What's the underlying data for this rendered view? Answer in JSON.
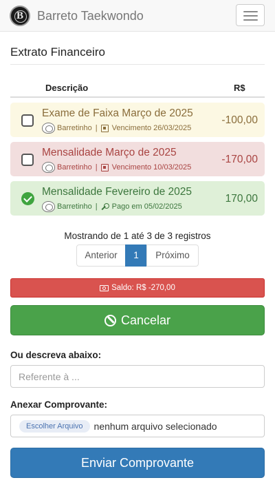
{
  "navbar": {
    "logo_letter": "B",
    "brand": "Barreto Taekwondo"
  },
  "page": {
    "title": "Extrato Financeiro"
  },
  "table": {
    "headers": {
      "description": "Descrição",
      "amount": "R$"
    },
    "rows": [
      {
        "status": "warning",
        "checked": false,
        "description": "Exame de Faixa Março de 2025",
        "user": "Barretinho",
        "date_text": "Vencimento 26/03/2025",
        "date_icon": "calendar-icon",
        "amount": "-100,00"
      },
      {
        "status": "danger",
        "checked": false,
        "description": "Mensalidade Março de 2025",
        "user": "Barretinho",
        "date_text": "Vencimento 10/03/2025",
        "date_icon": "calendar-icon",
        "amount": "-170,00"
      },
      {
        "status": "success",
        "checked": true,
        "description": "Mensalidade Fevereiro de 2025",
        "user": "Barretinho",
        "date_text": "Pago em 05/02/2025",
        "date_icon": "key-icon",
        "amount": "170,00"
      }
    ],
    "separator": "|"
  },
  "pagination": {
    "info": "Mostrando de 1 até 3 de 3 registros",
    "prev": "Anterior",
    "current": "1",
    "next": "Próximo"
  },
  "balance": {
    "text": "Saldo: R$ -270,00"
  },
  "cancel_button": {
    "label": "Cancelar"
  },
  "description_field": {
    "label": "Ou descreva abaixo:",
    "placeholder": "Referente à ..."
  },
  "attachment": {
    "label": "Anexar Comprovante:",
    "button": "Escolher Arquivo",
    "status": "nenhum arquivo selecionado"
  },
  "submit_button": {
    "label": "Enviar Comprovante"
  },
  "colors": {
    "warning_bg": "#fcf8e3",
    "danger_bg": "#f2dede",
    "success_bg": "#dff0d8",
    "primary": "#337ab7",
    "success": "#4aa24a",
    "danger": "#d9534f"
  }
}
